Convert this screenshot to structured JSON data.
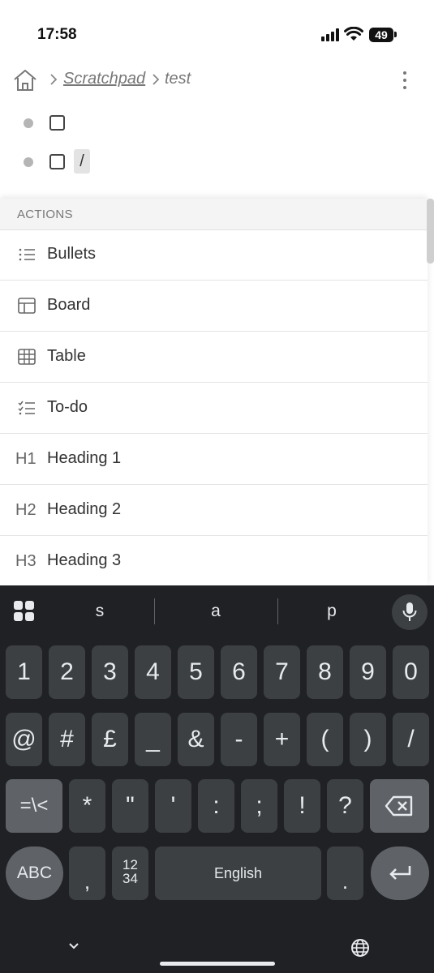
{
  "status_bar": {
    "time": "17:58",
    "battery": "49"
  },
  "breadcrumb": {
    "link": "Scratchpad",
    "current": "test"
  },
  "editor": {
    "slash_text": "/"
  },
  "actions": {
    "header": "ACTIONS",
    "items": [
      {
        "label": "Bullets",
        "icon": "list-icon"
      },
      {
        "label": "Board",
        "icon": "board-icon"
      },
      {
        "label": "Table",
        "icon": "table-icon"
      },
      {
        "label": "To-do",
        "icon": "todo-list-icon"
      },
      {
        "label": "Heading 1",
        "icon_text": "H1"
      },
      {
        "label": "Heading 2",
        "icon_text": "H2"
      },
      {
        "label": "Heading 3",
        "icon_text": "H3"
      }
    ]
  },
  "keyboard": {
    "suggestions": [
      "s",
      "a",
      "p"
    ],
    "row1": [
      "1",
      "2",
      "3",
      "4",
      "5",
      "6",
      "7",
      "8",
      "9",
      "0"
    ],
    "row2": [
      "@",
      "#",
      "£",
      "_",
      "&",
      "-",
      "+",
      "(",
      ")",
      "/"
    ],
    "row3": [
      "=\\<",
      "*",
      "\"",
      "'",
      ":",
      ";",
      "!",
      "?"
    ],
    "abc_label": "ABC",
    "comma": ",",
    "numpad_label": "12 34",
    "space_label": "English",
    "period": "."
  }
}
